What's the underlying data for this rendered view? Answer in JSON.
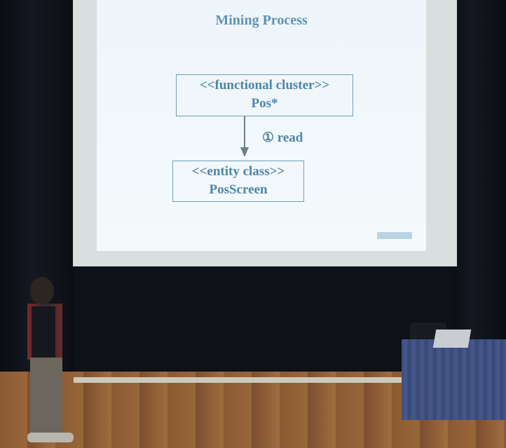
{
  "slide": {
    "title": "Mining Process",
    "box_top": {
      "stereotype": "<<functional cluster>>",
      "name": "Pos*"
    },
    "box_bottom": {
      "stereotype": "<<entity class>>",
      "name": "PosScreen"
    },
    "relation_label": "① read"
  },
  "colors": {
    "slide_text": "#4f86a6",
    "curtain": "#0b0d12",
    "floor": "#8a5a34",
    "table_cloth": "#3c4d7c"
  }
}
